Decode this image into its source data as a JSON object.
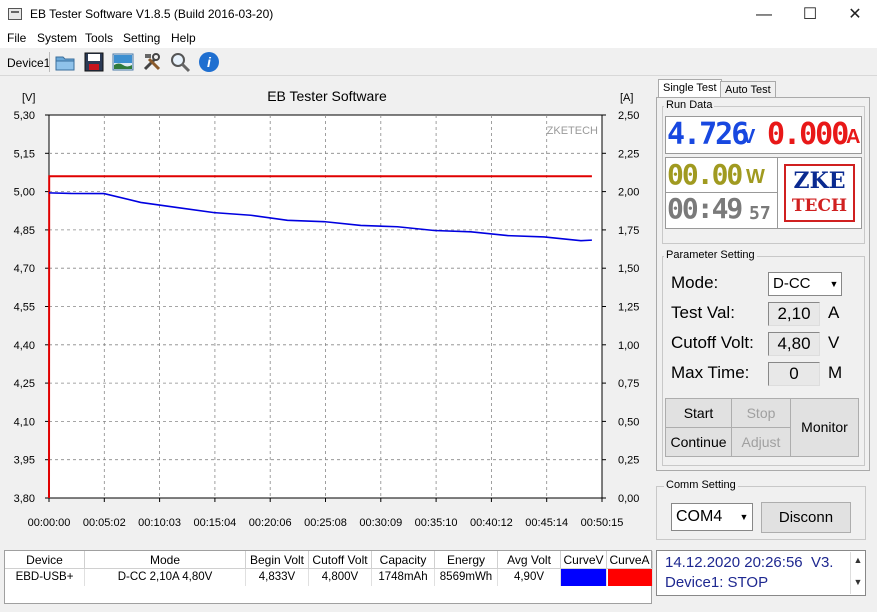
{
  "window": {
    "title": "EB Tester Software V1.8.5 (Build 2016-03-20)",
    "minimize": "—",
    "maximize": "☐",
    "close": "✕"
  },
  "menu": [
    "File",
    "System",
    "Tools",
    "Setting",
    "Help"
  ],
  "toolbar": {
    "device_label": "Device1",
    "icons": [
      "open-folder-icon",
      "save-icon",
      "image-icon",
      "tools-icon",
      "search-icon",
      "info-icon"
    ]
  },
  "chart": {
    "title": "EB Tester Software",
    "watermark": "ZKETECH",
    "left_unit": "[V]",
    "right_unit": "[A]",
    "y_left_ticks": [
      "5,30",
      "5,15",
      "5,00",
      "4,85",
      "4,70",
      "4,55",
      "4,40",
      "4,25",
      "4,10",
      "3,95",
      "3,80"
    ],
    "y_right_ticks": [
      "2,50",
      "2,25",
      "2,00",
      "1,75",
      "1,50",
      "1,25",
      "1,00",
      "0,75",
      "0,50",
      "0,25",
      "0,00"
    ],
    "x_ticks": [
      "00:00:00",
      "00:05:02",
      "00:10:03",
      "00:15:04",
      "00:20:06",
      "00:25:08",
      "00:30:09",
      "00:35:10",
      "00:40:12",
      "00:45:14",
      "00:50:15"
    ],
    "voltage_color": "#0000e0",
    "current_color": "#e00000"
  },
  "chart_data": {
    "type": "line",
    "title": "EB Tester Software",
    "xlabel": "",
    "ylabel": "[V]",
    "y2label": "[A]",
    "ylim": [
      3.8,
      5.3
    ],
    "y2lim": [
      0,
      2.5
    ],
    "xlim_seconds": [
      0,
      3015
    ],
    "grid": true,
    "series": [
      {
        "axis": "left",
        "x_seconds": [
          0,
          120,
          300,
          500,
          700,
          900,
          1100,
          1300,
          1500,
          1700,
          1900,
          2100,
          2300,
          2500,
          2700,
          2900,
          2960
        ],
        "values": [
          4.995,
          4.995,
          4.99,
          4.96,
          4.935,
          4.92,
          4.905,
          4.89,
          4.88,
          4.87,
          4.86,
          4.85,
          4.84,
          4.83,
          4.82,
          4.81,
          4.81
        ]
      },
      {
        "axis": "right",
        "x_seconds": [
          0,
          1,
          2960
        ],
        "values": [
          0,
          2.1,
          2.1
        ]
      }
    ]
  },
  "tabs": {
    "single": "Single Test",
    "auto": "Auto Test"
  },
  "run_data": {
    "group_label": "Run Data",
    "voltage": "4.726",
    "voltage_unit": "V",
    "current": "0.000",
    "current_unit": "A",
    "power": "00.00",
    "power_unit": "W",
    "time": "00:49",
    "time_small": "57",
    "logo_top": "ZKE",
    "logo_bottom": "TECH"
  },
  "params": {
    "group_label": "Parameter Setting",
    "mode_label": "Mode:",
    "mode_value": "D-CC",
    "test_val_label": "Test Val:",
    "test_val": "2,10",
    "test_val_unit": "A",
    "cutoff_label": "Cutoff Volt:",
    "cutoff_val": "4,80",
    "cutoff_unit": "V",
    "maxtime_label": "Max Time:",
    "maxtime_val": "0",
    "maxtime_unit": "M",
    "start": "Start",
    "stop": "Stop",
    "continue": "Continue",
    "adjust": "Adjust",
    "monitor": "Monitor"
  },
  "comm": {
    "group_label": "Comm Setting",
    "port": "COM4",
    "disconnect": "Disconn"
  },
  "table": {
    "headers": [
      "Device",
      "Mode",
      "Begin Volt",
      "Cutoff Volt",
      "Capacity",
      "Energy",
      "Avg Volt",
      "CurveV",
      "CurveA"
    ],
    "row": [
      "EBD-USB+",
      "D-CC  2,10A  4,80V",
      "4,833V",
      "4,800V",
      "1748mAh",
      "8569mWh",
      "4,90V",
      "",
      ""
    ],
    "curve_v_color": "#0000ff",
    "curve_a_color": "#ff0000"
  },
  "status": {
    "line1": "14.12.2020 20:26:56  V3.",
    "line2": "Device1: STOP"
  }
}
